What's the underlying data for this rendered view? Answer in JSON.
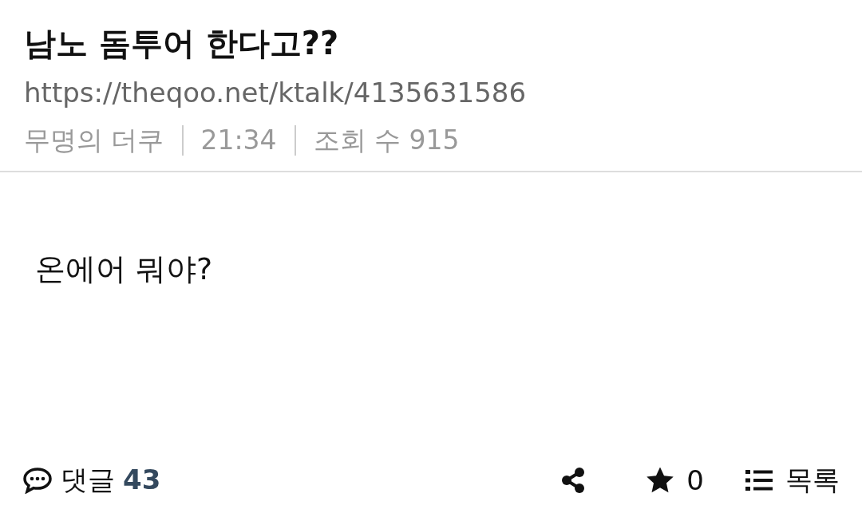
{
  "post": {
    "title": "남노 돔투어 한다고??",
    "url": "https://theqoo.net/ktalk/4135631586",
    "meta": [
      "무명의 더쿠",
      "21:34",
      "조회 수 915"
    ],
    "body": "온에어 뭐야?"
  },
  "footer": {
    "comment_label": "댓글",
    "comment_count": "43",
    "star_count": "0",
    "list_label": "목록"
  }
}
